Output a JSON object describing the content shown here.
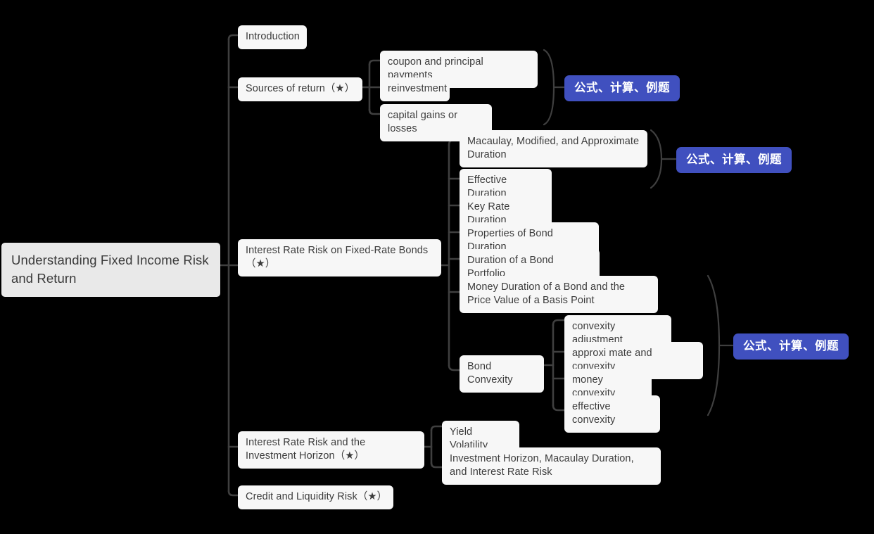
{
  "theme": {
    "background": "#000000",
    "node_bg": "#f7f7f7",
    "node_text": "#3c3c3c",
    "root_bg": "#e9e9e9",
    "badge_bg": "#4050bf",
    "badge_text": "#ffffff",
    "link_color": "#3f3f3f"
  },
  "mindmap": {
    "root": {
      "label": "Understanding Fixed Income Risk and Return"
    },
    "branches": {
      "introduction": {
        "label": "Introduction"
      },
      "sources_of_return": {
        "label": "Sources of return（★）",
        "children": [
          {
            "label": "coupon and principal payments"
          },
          {
            "label": "reinvestment"
          },
          {
            "label": "capital gains or losses"
          }
        ],
        "badge": "公式、计算、例题"
      },
      "interest_rate_risk_fixed_rate_bonds": {
        "label": "Interest Rate Risk on Fixed-Rate Bonds（★）",
        "children": [
          {
            "label": "Macaulay, Modified, and Approximate Duration"
          },
          {
            "label": "Effective Duration"
          },
          {
            "label": "Key Rate Duration"
          },
          {
            "label": "Properties of Bond Duration"
          },
          {
            "label": "Duration of a Bond Portfolio"
          },
          {
            "label": "Money Duration of a Bond and the Price Value of a Basis Point"
          },
          {
            "label": "Bond Convexity",
            "children": [
              {
                "label": "convexity adjustment"
              },
              {
                "label": "approxi mate and convexity"
              },
              {
                "label": "money convexity"
              },
              {
                "label": "effective convexity"
              }
            ],
            "badge": "公式、计算、例题"
          }
        ],
        "badge": "公式、计算、例题"
      },
      "interest_rate_risk_investment_horizon": {
        "label": "Interest Rate Risk and the Investment Horizon（★）",
        "children": [
          {
            "label": "Yield Volatility"
          },
          {
            "label": "Investment Horizon, Macaulay Duration, and Interest Rate Risk"
          }
        ]
      },
      "credit_and_liquidity_risk": {
        "label": "Credit and Liquidity Risk（★）"
      }
    }
  }
}
